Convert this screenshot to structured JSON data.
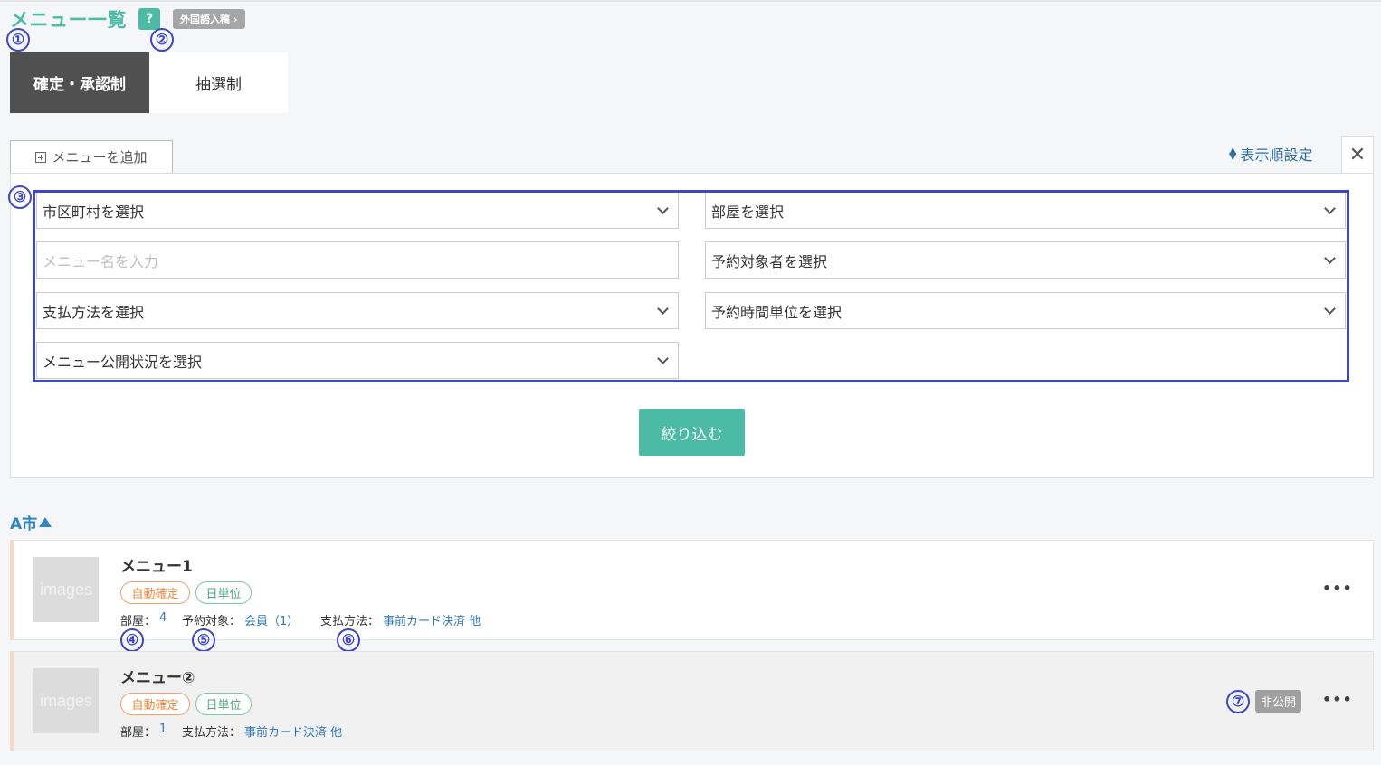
{
  "header": {
    "title": "メニュー一覧",
    "help_label": "?",
    "foreign_label": "外国語入稿",
    "foreign_chevron": "›"
  },
  "annotations": [
    "①",
    "②",
    "③",
    "④",
    "⑤",
    "⑥",
    "⑦"
  ],
  "tabs": [
    {
      "label": "確定・承認制",
      "active": true
    },
    {
      "label": "抽選制",
      "active": false
    }
  ],
  "toolbar": {
    "add_menu_label": "メニューを追加",
    "display_order_label": "表示順設定",
    "close_glyph": "✕"
  },
  "filters": {
    "city": "市区町村を選択",
    "room": "部屋を選択",
    "menu_name_placeholder": "メニュー名を入力",
    "target": "予約対象者を選択",
    "payment": "支払方法を選択",
    "time_unit": "予約時間単位を選択",
    "publish_status": "メニュー公開状況を選択",
    "submit_label": "絞り込む"
  },
  "city_group": {
    "name": "A市"
  },
  "menus": [
    {
      "name": "メニュー1",
      "thumb": "images",
      "badges": [
        "自動確定",
        "日単位"
      ],
      "room_label": "部屋：",
      "room_value": "4",
      "target_label": "予約対象：",
      "target_value": "会員（1）",
      "payment_label": "支払方法：",
      "payment_value": "事前カード決済 他",
      "more": "•••"
    },
    {
      "name": "メニュー②",
      "thumb": "images",
      "badges": [
        "自動確定",
        "日単位"
      ],
      "room_label": "部屋：",
      "room_value": "1",
      "payment_label": "支払方法：",
      "payment_value": "事前カード決済 他",
      "status_badge": "非公開",
      "more": "•••"
    }
  ],
  "colors": {
    "accent": "#4cbba6",
    "annotation": "#3f47c4",
    "link": "#2f78b8"
  }
}
